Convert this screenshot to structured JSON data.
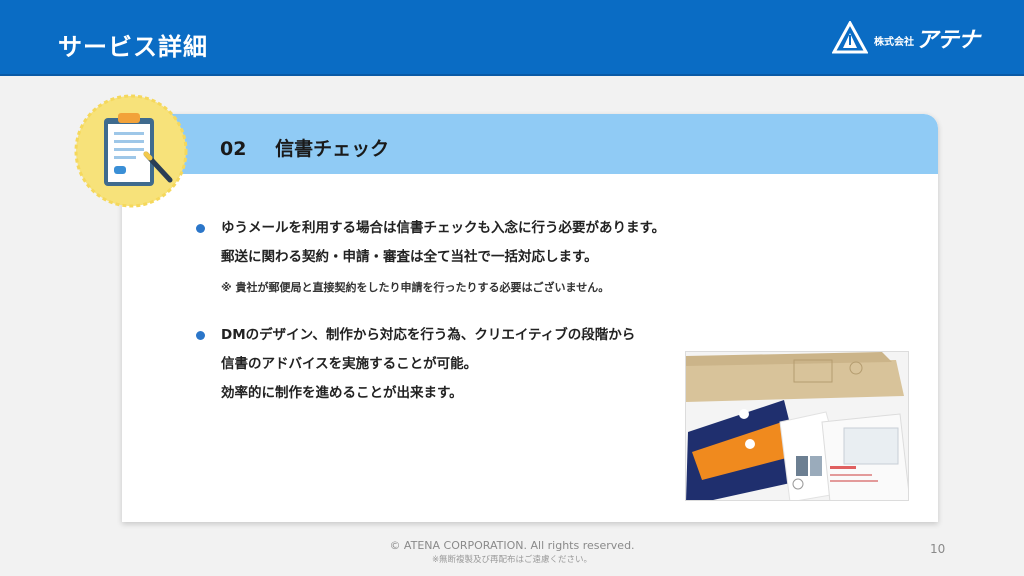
{
  "header": {
    "title": "サービス詳細",
    "logo_small": "株式会社",
    "logo_main": "アテナ"
  },
  "card": {
    "number": "02",
    "heading": "信書チェック",
    "bullets": [
      {
        "lines": [
          "ゆうメールを利用する場合は信書チェックも入念に行う必要があります。",
          "郵送に関わる契約・申請・審査は全て当社で一括対応します。"
        ],
        "note": "※ 貴社が郵便局と直接契約をしたり申請を行ったりする必要はございません。"
      },
      {
        "lines": [
          "DMのデザイン、制作から対応を行う為、クリエイティブの段階から",
          "信書のアドバイスを実施することが可能。",
          "効率的に制作を進めることが出来ます。"
        ]
      }
    ]
  },
  "footer": {
    "copyright": "© ATENA CORPORATION. All rights reserved.",
    "note": "※無断複製及び再配布はご遠慮ください。",
    "page_number": "10"
  },
  "icons": {
    "badge": "clipboard-icon",
    "logo": "atena-logo-icon"
  },
  "colors": {
    "header": "#0a6cc4",
    "band": "#90cbf5",
    "bullet": "#2b76c9",
    "badge": "#f7e27a"
  }
}
